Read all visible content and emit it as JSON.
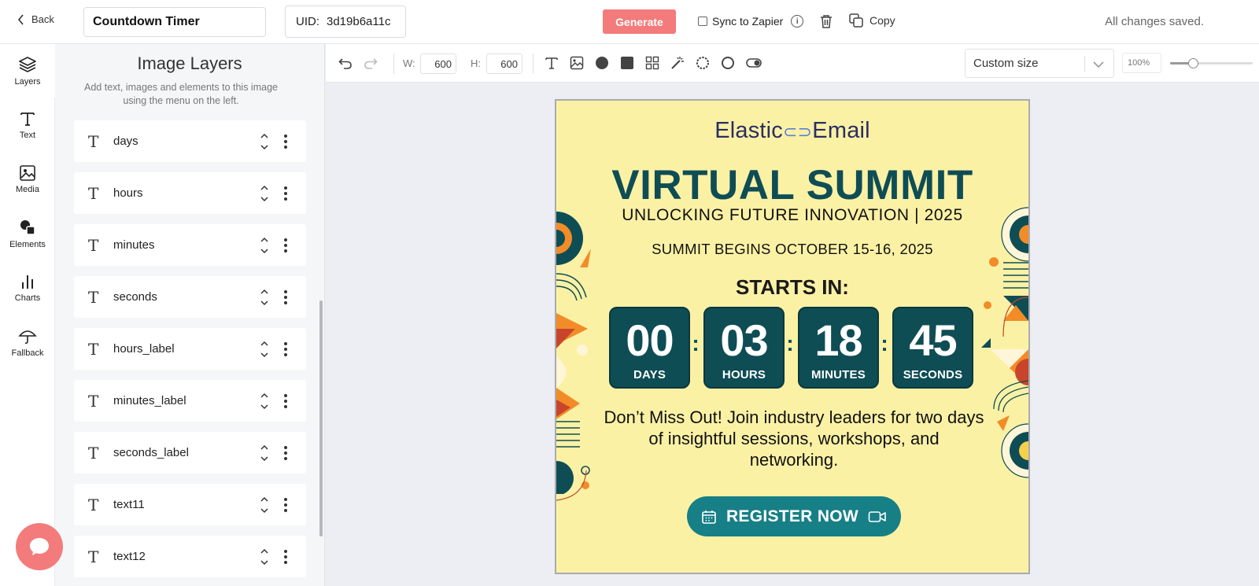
{
  "topbar": {
    "back_label": "Back",
    "title_value": "Countdown Timer",
    "uid_label": "UID:",
    "uid_value": "3d19b6a11c",
    "generate_label": "Generate",
    "sync_label": "Sync to Zapier",
    "copy_label": "Copy",
    "status": "All changes saved."
  },
  "leftnav": {
    "items": [
      {
        "label": "Layers",
        "icon": "layers-icon"
      },
      {
        "label": "Text",
        "icon": "text-icon"
      },
      {
        "label": "Media",
        "icon": "image-icon"
      },
      {
        "label": "Elements",
        "icon": "shapes-icon"
      },
      {
        "label": "Charts",
        "icon": "bar-chart-icon"
      },
      {
        "label": "Fallback",
        "icon": "umbrella-icon"
      }
    ]
  },
  "layers": {
    "title": "Image Layers",
    "description": "Add text, images and elements to this image using the menu on the left.",
    "items": [
      "days",
      "hours",
      "minutes",
      "seconds",
      "hours_label",
      "minutes_label",
      "seconds_label",
      "text11",
      "text12"
    ]
  },
  "toolbar": {
    "width_label": "W:",
    "width_value": "600",
    "height_label": "H:",
    "height_value": "600",
    "size_select": "Custom size",
    "zoom": "100%",
    "zoom_fraction": 0.28
  },
  "canvas": {
    "logo_left": "Elastic",
    "logo_right": "Email",
    "headline": "VIRTUAL SUMMIT",
    "subheadline": "UNLOCKING FUTURE INNOVATION | 2025",
    "dates": "SUMMIT BEGINS OCTOBER 15-16, 2025",
    "starts_in": "STARTS IN:",
    "countdown": [
      {
        "value": "00",
        "label": "DAYS"
      },
      {
        "value": "03",
        "label": "HOURS"
      },
      {
        "value": "18",
        "label": "MINUTES"
      },
      {
        "value": "45",
        "label": "SECONDS"
      }
    ],
    "body": "Don’t Miss Out! Join industry leaders for two days of insightful sessions, workshops, and networking.",
    "register_label": "REGISTER NOW"
  },
  "colors": {
    "accent": "#f47b7b",
    "canvas_bg": "#fbf1a5",
    "teal_dark": "#0f4d55",
    "teal_button": "#177f86",
    "orange": "#f28c28"
  }
}
